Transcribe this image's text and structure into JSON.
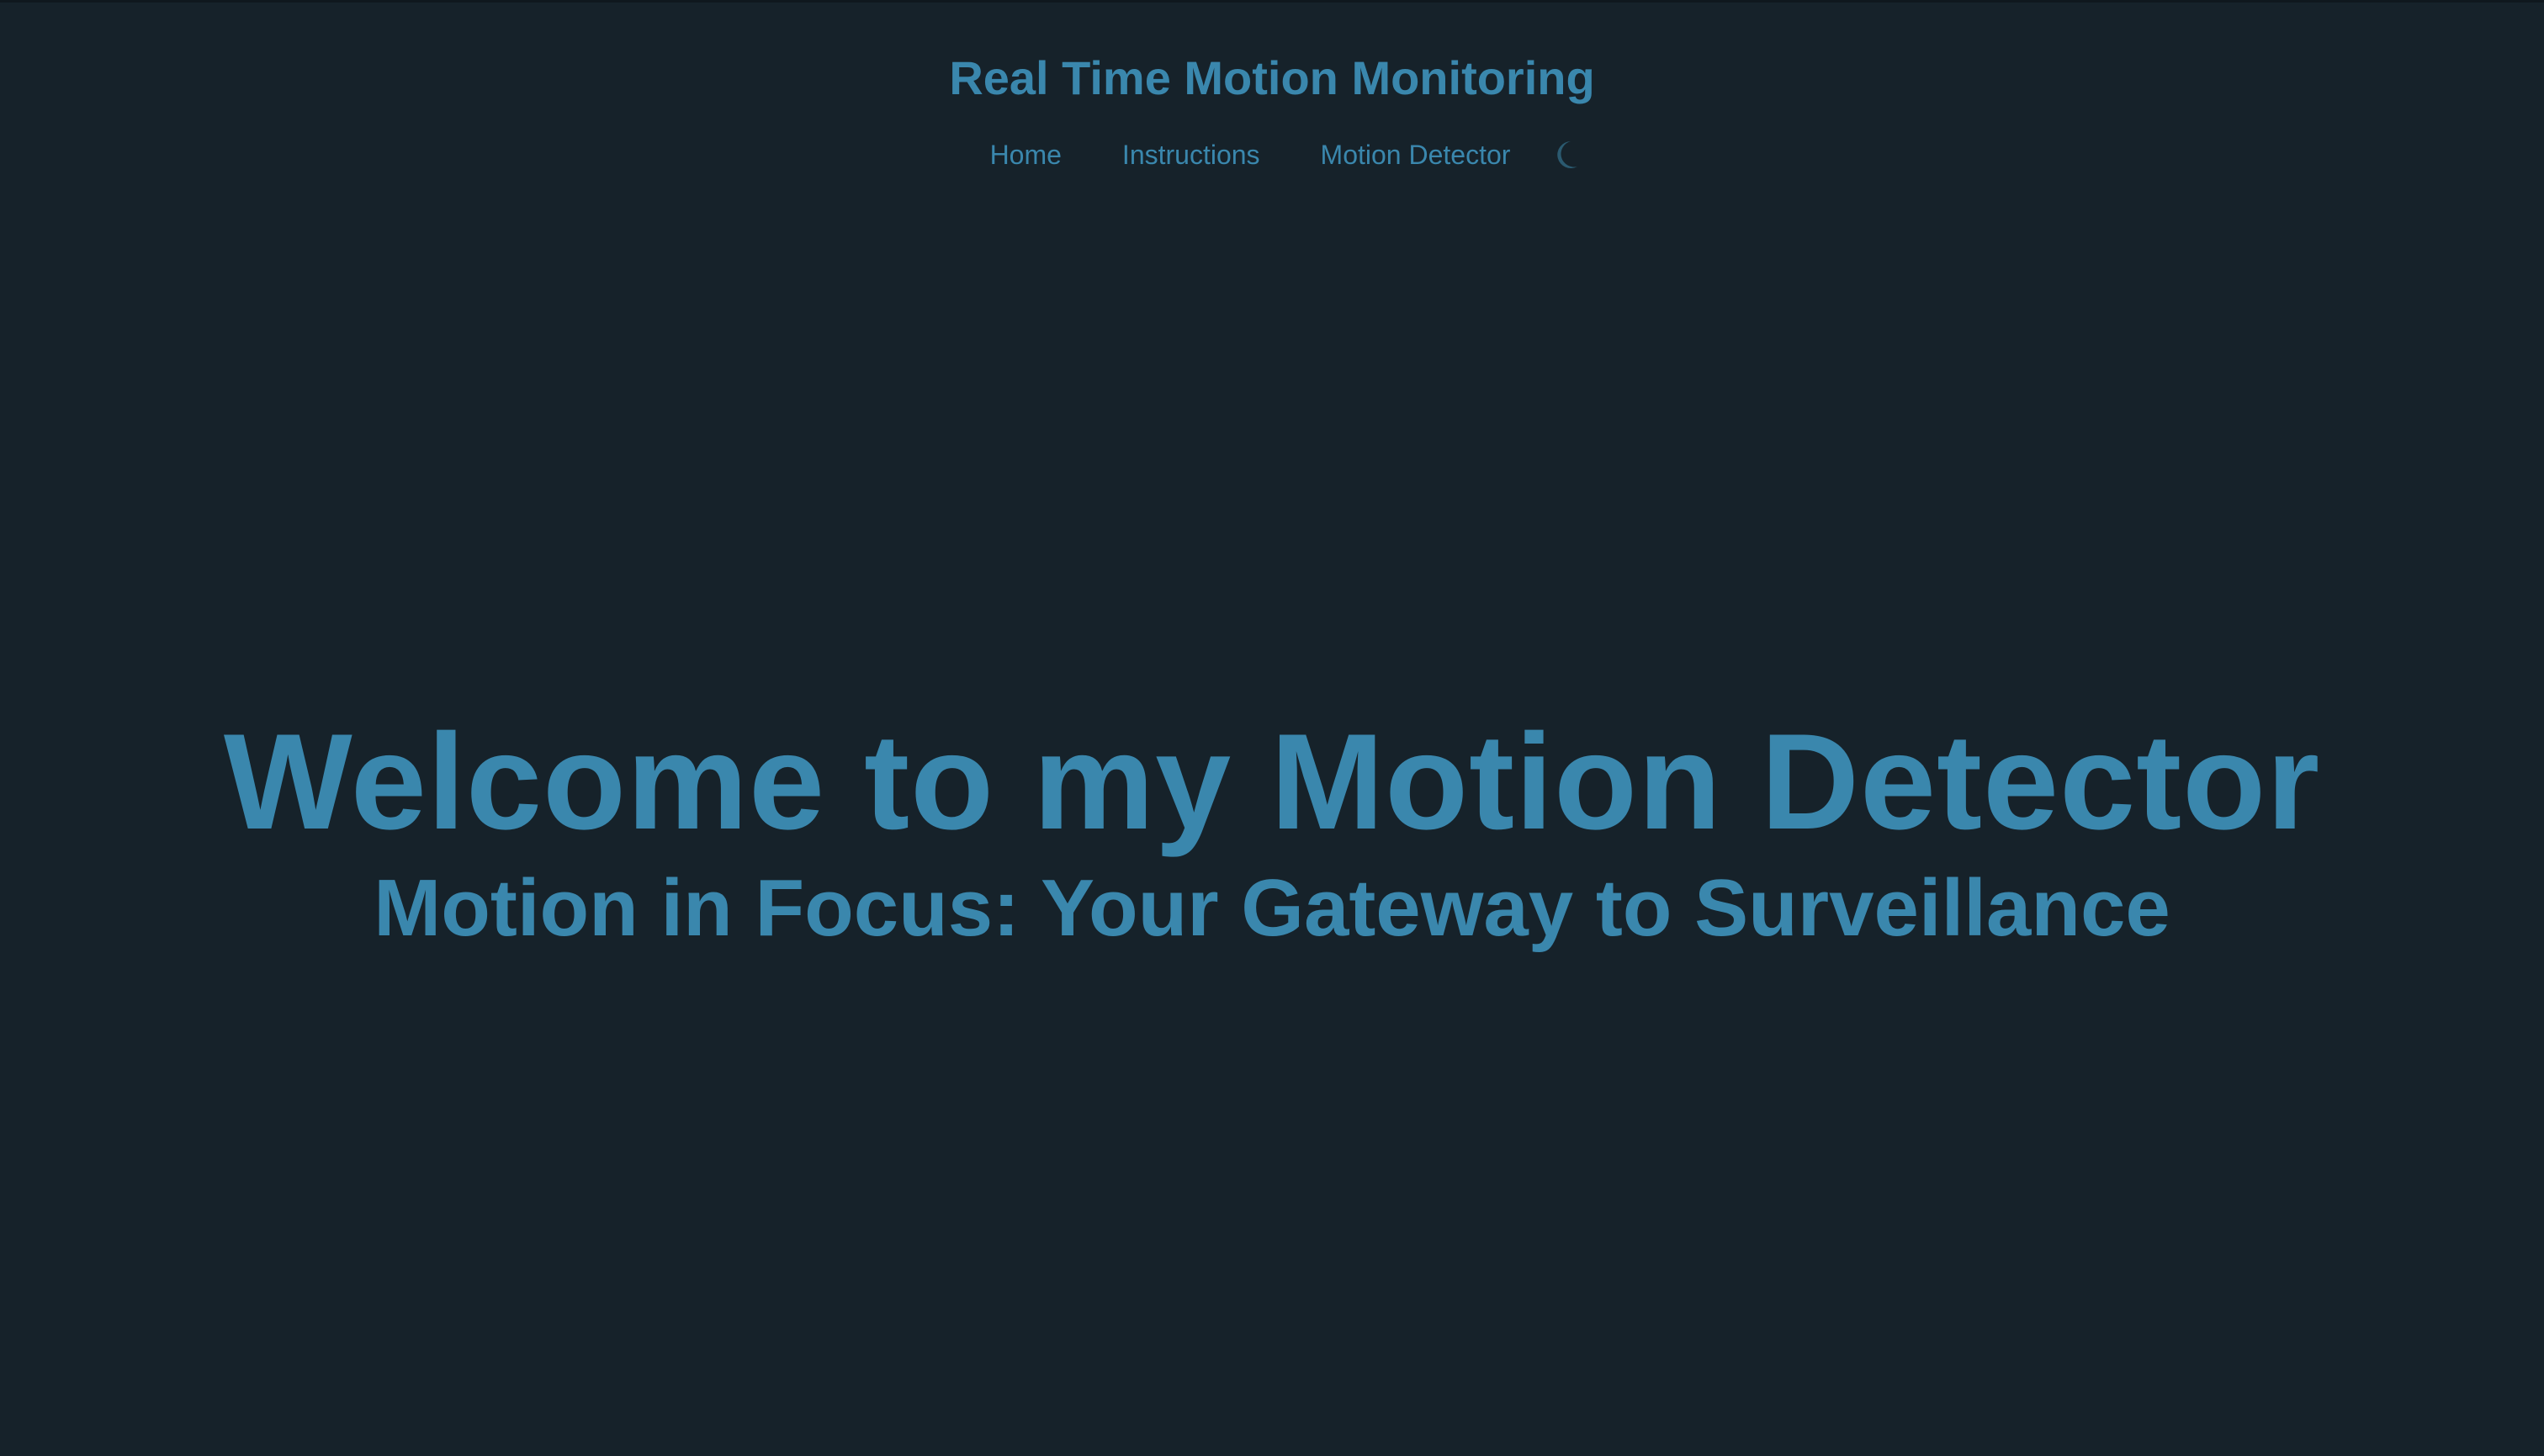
{
  "header": {
    "title": "Real Time Motion Monitoring",
    "nav": [
      {
        "label": "Home"
      },
      {
        "label": "Instructions"
      },
      {
        "label": "Motion Detector"
      }
    ],
    "theme_toggle_icon": "moon-icon"
  },
  "hero": {
    "title": "Welcome to my Motion Detector",
    "subtitle": "Motion in Focus: Your Gateway to Surveillance"
  },
  "colors": {
    "background": "#16222a",
    "accent": "#3a87ad",
    "icon_muted": "#2b5a70"
  }
}
